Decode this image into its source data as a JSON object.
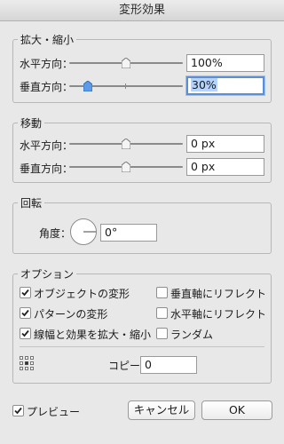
{
  "window": {
    "title": "変形効果"
  },
  "scale": {
    "title": "拡大・縮小",
    "horizontal": {
      "label": "水平方向：",
      "value": "100%",
      "level_percent": 100
    },
    "vertical": {
      "label": "垂直方向：",
      "value": "30%",
      "level_percent": 30
    }
  },
  "move": {
    "title": "移動",
    "horizontal": {
      "label": "水平方向：",
      "value": "0 px"
    },
    "vertical": {
      "label": "垂直方向：",
      "value": "0 px"
    }
  },
  "rotate": {
    "title": "回転",
    "angle_label": "角度：",
    "angle_value": "0°"
  },
  "options": {
    "title": "オプション",
    "transform_objects": {
      "label": "オブジェクトの変形",
      "checked": true
    },
    "transform_patterns": {
      "label": "パターンの変形",
      "checked": true
    },
    "scale_strokes": {
      "label": "線幅と効果を拡大・縮小",
      "checked": true
    },
    "reflect_x": {
      "label": "垂直軸にリフレクト",
      "checked": false
    },
    "reflect_y": {
      "label": "水平軸にリフレクト",
      "checked": false
    },
    "random": {
      "label": "ランダム",
      "checked": false
    },
    "copies_label": "コピー",
    "copies_value": "0"
  },
  "footer": {
    "preview": {
      "label": "プレビュー",
      "checked": true
    },
    "cancel_label": "キャンセル",
    "ok_label": "OK"
  }
}
